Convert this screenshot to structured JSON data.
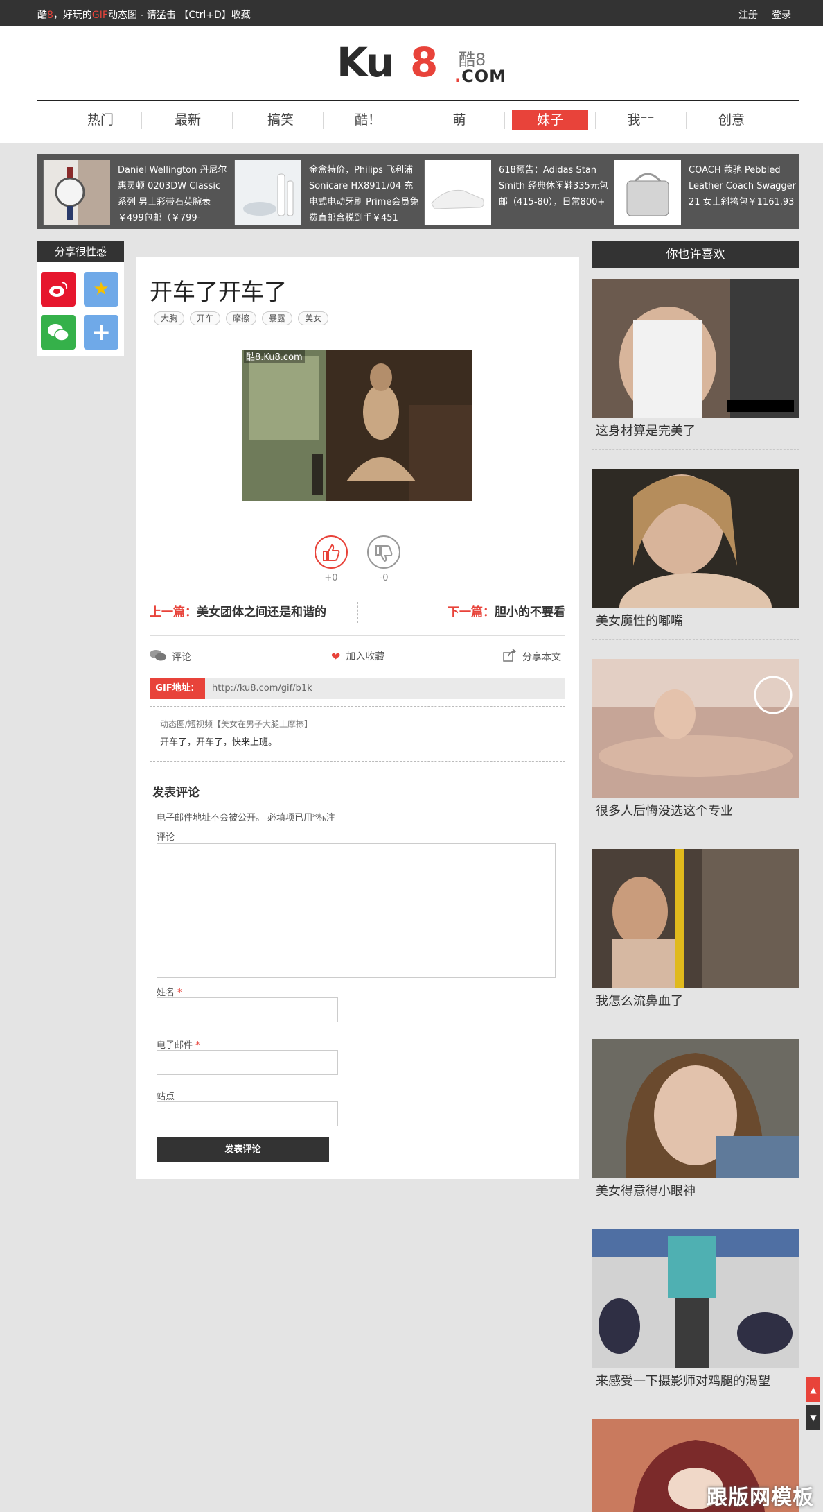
{
  "topbar": {
    "tagline_pre": "酷",
    "tagline_red1": "8",
    "tagline_mid": "，好玩的",
    "tagline_red2": "GIF",
    "tagline_post": "动态图 - 请猛击 【Ctrl+D】收藏",
    "register": "注册",
    "login": "登录"
  },
  "logo": {
    "ku": "Ku",
    "eight": "8",
    "cn": "酷8",
    "dot": ".",
    "com": "COM"
  },
  "nav": {
    "items": [
      {
        "label": "热门"
      },
      {
        "label": "最新"
      },
      {
        "label": "搞笑"
      },
      {
        "label": "酷！"
      },
      {
        "label": "萌"
      },
      {
        "label": "妹子"
      },
      {
        "label": "我⁺⁺"
      },
      {
        "label": "创意"
      }
    ],
    "active_index": 5
  },
  "products": [
    {
      "text": "Daniel Wellington 丹尼尔惠灵顿 0203DW Classic系列 男士彩带石英腕表 ￥499包邮（￥799-"
    },
    {
      "text": "金盒特价，Philips 飞利浦 Sonicare HX8911/04 充电式电动牙刷 Prime会员免费直邮含税到手￥451"
    },
    {
      "text": "618预告：Adidas Stan Smith 经典休闲鞋335元包邮（415-80），日常800+"
    },
    {
      "text": "COACH 蔻驰 Pebbled Leather Coach Swagger 21 女士斜挎包￥1161.93"
    }
  ],
  "share": {
    "title": "分享很性感",
    "buttons": [
      {
        "name": "weibo",
        "color": "#e6162d"
      },
      {
        "name": "qzone",
        "color": "#6fa9e8"
      },
      {
        "name": "wechat",
        "color": "#35b14a"
      },
      {
        "name": "more",
        "color": "#6fa9e8"
      }
    ]
  },
  "article": {
    "title": "开车了开车了",
    "tags": [
      "大胸",
      "开车",
      "摩擦",
      "暴露",
      "美女"
    ],
    "image_watermark": "酷8.Ku8.com",
    "up_count": "+0",
    "down_count": "-0",
    "prev_label": "上一篇：",
    "prev_title": "美女团体之间还是和谐的",
    "next_label": "下一篇：",
    "next_title": "胆小的不要看",
    "comment_action": "评论",
    "favorite_action": "加入收藏",
    "share_action": "分享本文",
    "gif_label": "GIF地址：",
    "gif_url": "http://ku8.com/gif/b1k",
    "desc_line1": "动态图/短视频【美女在男子大腿上摩擦】",
    "desc_line2": "开车了，开车了，快来上班。"
  },
  "comment_form": {
    "title": "发表评论",
    "note": "电子邮件地址不会被公开。 必填项已用*标注",
    "comment_label": "评论",
    "name_label": "姓名",
    "email_label": "电子邮件",
    "site_label": "站点",
    "required_mark": "*",
    "submit": "发表评论"
  },
  "sidebar": {
    "title": "你也许喜欢",
    "items": [
      {
        "caption": "这身材算是完美了"
      },
      {
        "caption": "美女魔性的嘟嘴"
      },
      {
        "caption": "很多人后悔没选这个专业"
      },
      {
        "caption": "我怎么流鼻血了"
      },
      {
        "caption": "美女得意得小眼神"
      },
      {
        "caption": "来感受一下摄影师对鸡腿的渴望"
      },
      {
        "caption": ""
      }
    ]
  },
  "watermark_stamp": "跟版网模板",
  "colors": {
    "accent": "#e8433a",
    "dark": "#333333",
    "page_bg": "#e4e4e4"
  }
}
